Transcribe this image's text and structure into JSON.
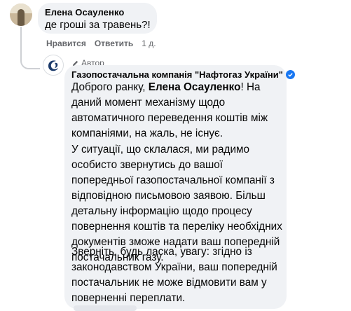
{
  "comment": {
    "author": "Елена Осауленко",
    "text": "де гроші за травень?!",
    "actions": {
      "like": "Нравится",
      "reply": "Ответить",
      "time": "1 д."
    }
  },
  "reply": {
    "badge": "Автор",
    "author": "Газопостачальна компанія \"Нафтогаз України\"",
    "greeting_prefix": "Доброго ранку, ",
    "greeting_name": "Елена Осауленко",
    "greeting_suffix": "! На даний момент механізму щодо автоматичного переведення коштів між компаніями, на жаль, не існує.",
    "paragraph2": "У ситуації, що склалася, ми радимо особисто звернутись до вашої попередньої газопостачальної компанії з відповідною письмовою заявою. Більш детальну інформацію щодо процесу повернення коштів та переліку необхідних документів зможе надати ваш попередній постачальник газу.",
    "paragraph3": "Зверніть, будь ласка, увагу: згідно із законодавством України, ваш попередній постачальник не може відмовити вам у поверненні переплати."
  },
  "colors": {
    "bubble": "#f0f2f5",
    "meta": "#65676b",
    "verified": "#1877f2",
    "link": "#050505"
  }
}
